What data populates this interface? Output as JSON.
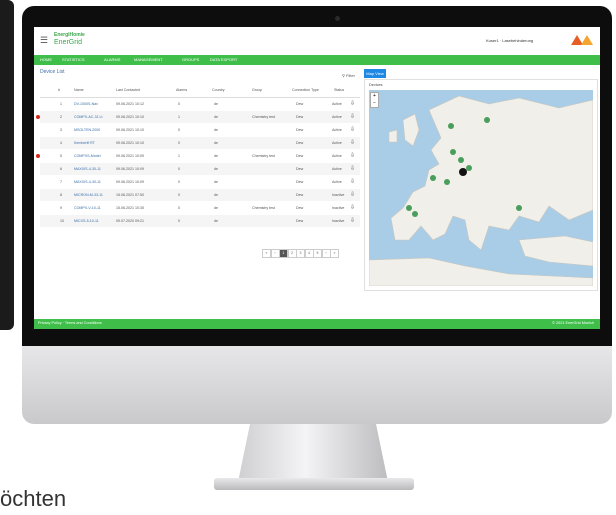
{
  "app": {
    "brand_top": "EnergiHomie",
    "brand_name": "EnerGrid",
    "user_label": "Kuser1 · Lasebehinderung",
    "menu_icon": "hamburger-icon"
  },
  "nav": {
    "items": [
      "Home",
      "Statistics",
      "Alarms",
      "Management",
      "Groups",
      "Data Export"
    ]
  },
  "device_list": {
    "title": "Device List",
    "filter_label": "Filter",
    "columns": [
      "#",
      "Name",
      "Last Contacted",
      "Alarms",
      "Country",
      "Group",
      "Connection Type",
      "Status"
    ],
    "rows": [
      {
        "num": "1",
        "name": "DV-1000S-Nav",
        "contacted": "09.06.2021 10:12",
        "alarms": "0",
        "country": "de",
        "group": "",
        "conn": "Dew",
        "status": "Active",
        "alert": false
      },
      {
        "num": "2",
        "name": "COMPX-AC-31 Lt",
        "contacted": "09.06.2021 10:10",
        "alarms": "1",
        "country": "de",
        "group": "Chemistry test",
        "conn": "Dew",
        "status": "Active",
        "alert": true
      },
      {
        "num": "3",
        "name": "MSOLTEN-2000",
        "contacted": "09.06.2021 10:10",
        "alarms": "0",
        "country": "de",
        "group": "",
        "conn": "Dew",
        "status": "Active",
        "alert": false
      },
      {
        "num": "4",
        "name": "Kemberlif RT",
        "contacted": "09.06.2021 10:10",
        "alarms": "0",
        "country": "de",
        "group": "",
        "conn": "Dew",
        "status": "Active",
        "alert": false
      },
      {
        "num": "5",
        "name": "COMPXS-Model",
        "contacted": "09.06.2021 10:09",
        "alarms": "1",
        "country": "de",
        "group": "Chemistry test",
        "conn": "Dew",
        "status": "Active",
        "alert": true
      },
      {
        "num": "6",
        "name": "MAXXIS-4-30-11",
        "contacted": "09.06.2021 10:09",
        "alarms": "0",
        "country": "de",
        "group": "",
        "conn": "Dew",
        "status": "Active",
        "alert": false
      },
      {
        "num": "7",
        "name": "MAXXIS-4-30-11",
        "contacted": "09.06.2021 10:09",
        "alarms": "0",
        "country": "de",
        "group": "",
        "conn": "Dew",
        "status": "Active",
        "alert": false
      },
      {
        "num": "8",
        "name": "MICRON-M-33-11",
        "contacted": "15.06.2021 07:50",
        "alarms": "0",
        "country": "de",
        "group": "",
        "conn": "Dew",
        "status": "Inactive",
        "alert": false
      },
      {
        "num": "9",
        "name": "COMPX-V-10-11",
        "contacted": "15.06.2021 10:35",
        "alarms": "0",
        "country": "de",
        "group": "Chemistry test",
        "conn": "Dew",
        "status": "Inactive",
        "alert": false
      },
      {
        "num": "10",
        "name": "MICXS-5-10-11",
        "contacted": "09.07.2020 09:21",
        "alarms": "0",
        "country": "de",
        "group": "",
        "conn": "Dew",
        "status": "Inactive",
        "alert": false
      }
    ],
    "pagination": [
      "«",
      "‹",
      "1",
      "2",
      "3",
      "4",
      "5",
      "›",
      "»"
    ],
    "active_page": "1"
  },
  "map": {
    "tab_label": "Map View",
    "panel_label": "Devices",
    "zoom_in": "+",
    "zoom_out": "−"
  },
  "footer": {
    "left": "Privacy Policy · Terms and Conditions",
    "right": "© 2021 EnerGrid Munich"
  },
  "caption": "öchten"
}
